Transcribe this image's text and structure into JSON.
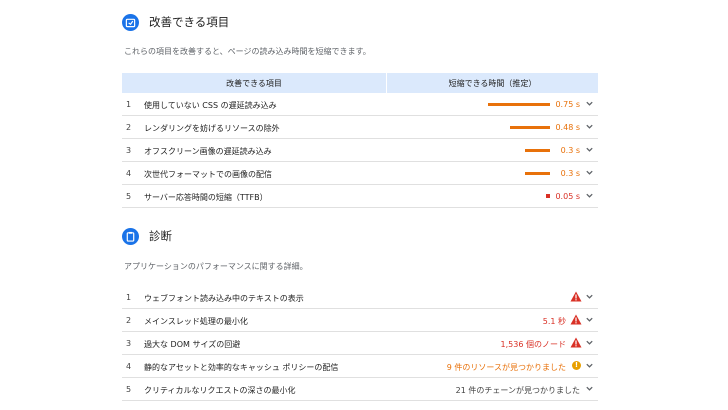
{
  "opportunities": {
    "title": "改善できる項目",
    "icon": "opportunity-icon",
    "description": "これらの項目を改善すると、ページの読み込み時間を短縮できます。",
    "col_item": "改善できる項目",
    "col_savings": "短縮できる時間（推定）",
    "items": [
      {
        "index": "1",
        "label": "使用していない CSS の遅延読み込み",
        "value": "0.75 s",
        "fraction": 1.0
      },
      {
        "index": "2",
        "label": "レンダリングを妨げるリソースの除外",
        "value": "0.48 s",
        "fraction": 0.64
      },
      {
        "index": "3",
        "label": "オフスクリーン画像の遅延読み込み",
        "value": "0.3 s",
        "fraction": 0.4
      },
      {
        "index": "4",
        "label": "次世代フォーマットでの画像の配信",
        "value": "0.3 s",
        "fraction": 0.4
      },
      {
        "index": "5",
        "label": "サーバー応答時間の短縮（TTFB）",
        "value": "0.05 s",
        "fraction": 0.067
      }
    ]
  },
  "diagnostics": {
    "title": "診断",
    "icon": "clipboard-icon",
    "description": "アプリケーションのパフォーマンスに関する詳細。",
    "items": [
      {
        "index": "1",
        "label": "ウェブフォント読み込み中のテキストの表示",
        "value": "",
        "status": "warning-triangle"
      },
      {
        "index": "2",
        "label": "メインスレッド処理の最小化",
        "value": "5.1 秒",
        "status": "warning-triangle"
      },
      {
        "index": "3",
        "label": "過大な DOM サイズの回避",
        "value": "1,536 個のノード",
        "status": "warning-triangle"
      },
      {
        "index": "4",
        "label": "静的なアセットと効率的なキャッシュ ポリシーの配信",
        "value": "9 件のリソースが見つかりました",
        "status": "info-circle"
      },
      {
        "index": "5",
        "label": "クリティカルなリクエストの深さの最小化",
        "value": "21 件のチェーンが見つかりました",
        "status": "none"
      }
    ]
  },
  "colors": {
    "accent": "#1a73e8",
    "bar": "#e8710a",
    "fail": "#d93025",
    "average": "#e8a000",
    "header_bg": "#dbe9fc"
  }
}
